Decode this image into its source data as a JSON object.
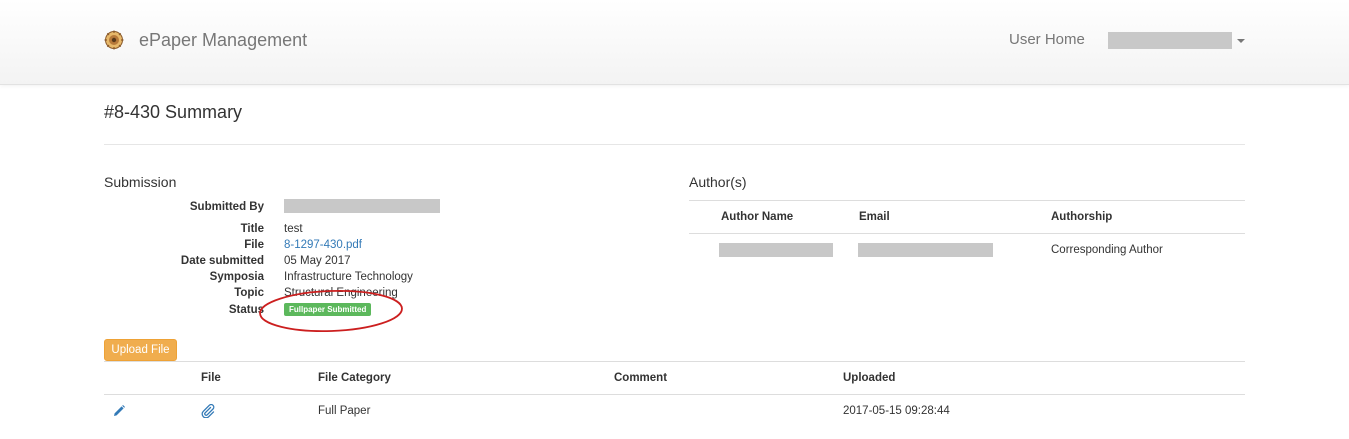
{
  "navbar": {
    "brand": "ePaper Management",
    "logo_icon": "sun-seal-logo",
    "user_home": "User Home",
    "user_menu_icon": "caret-down-icon"
  },
  "page": {
    "title": "#8-430 Summary"
  },
  "submission": {
    "heading": "Submission",
    "fields": [
      {
        "label": "Submitted By",
        "value": ""
      },
      {
        "label": "Title",
        "value": "test"
      },
      {
        "label": "File",
        "value": "8-1297-430.pdf"
      },
      {
        "label": "Date submitted",
        "value": "05 May 2017"
      },
      {
        "label": "Symposia",
        "value": "Infrastructure Technology"
      },
      {
        "label": "Topic",
        "value": "Structural Engineering"
      },
      {
        "label": "Status",
        "value": "Fullpaper Submitted"
      }
    ],
    "status_color": "#5cb85c",
    "annotation_color": "#cc1f1f"
  },
  "authors": {
    "heading": "Author(s)",
    "columns": [
      "Author Name",
      "Email",
      "Authorship"
    ],
    "rows": [
      {
        "name": "",
        "email": "",
        "authorship": "Corresponding Author"
      }
    ]
  },
  "upload_button": {
    "label": "Upload File",
    "color": "#f0ad4e"
  },
  "files": {
    "columns": [
      "",
      "File",
      "File Category",
      "Comment",
      "Uploaded"
    ],
    "rows": [
      {
        "edit_icon": "pencil-icon",
        "file_icon": "paperclip-icon",
        "category": "Full Paper",
        "comment": "",
        "uploaded": "2017-05-15 09:28:44"
      }
    ]
  }
}
